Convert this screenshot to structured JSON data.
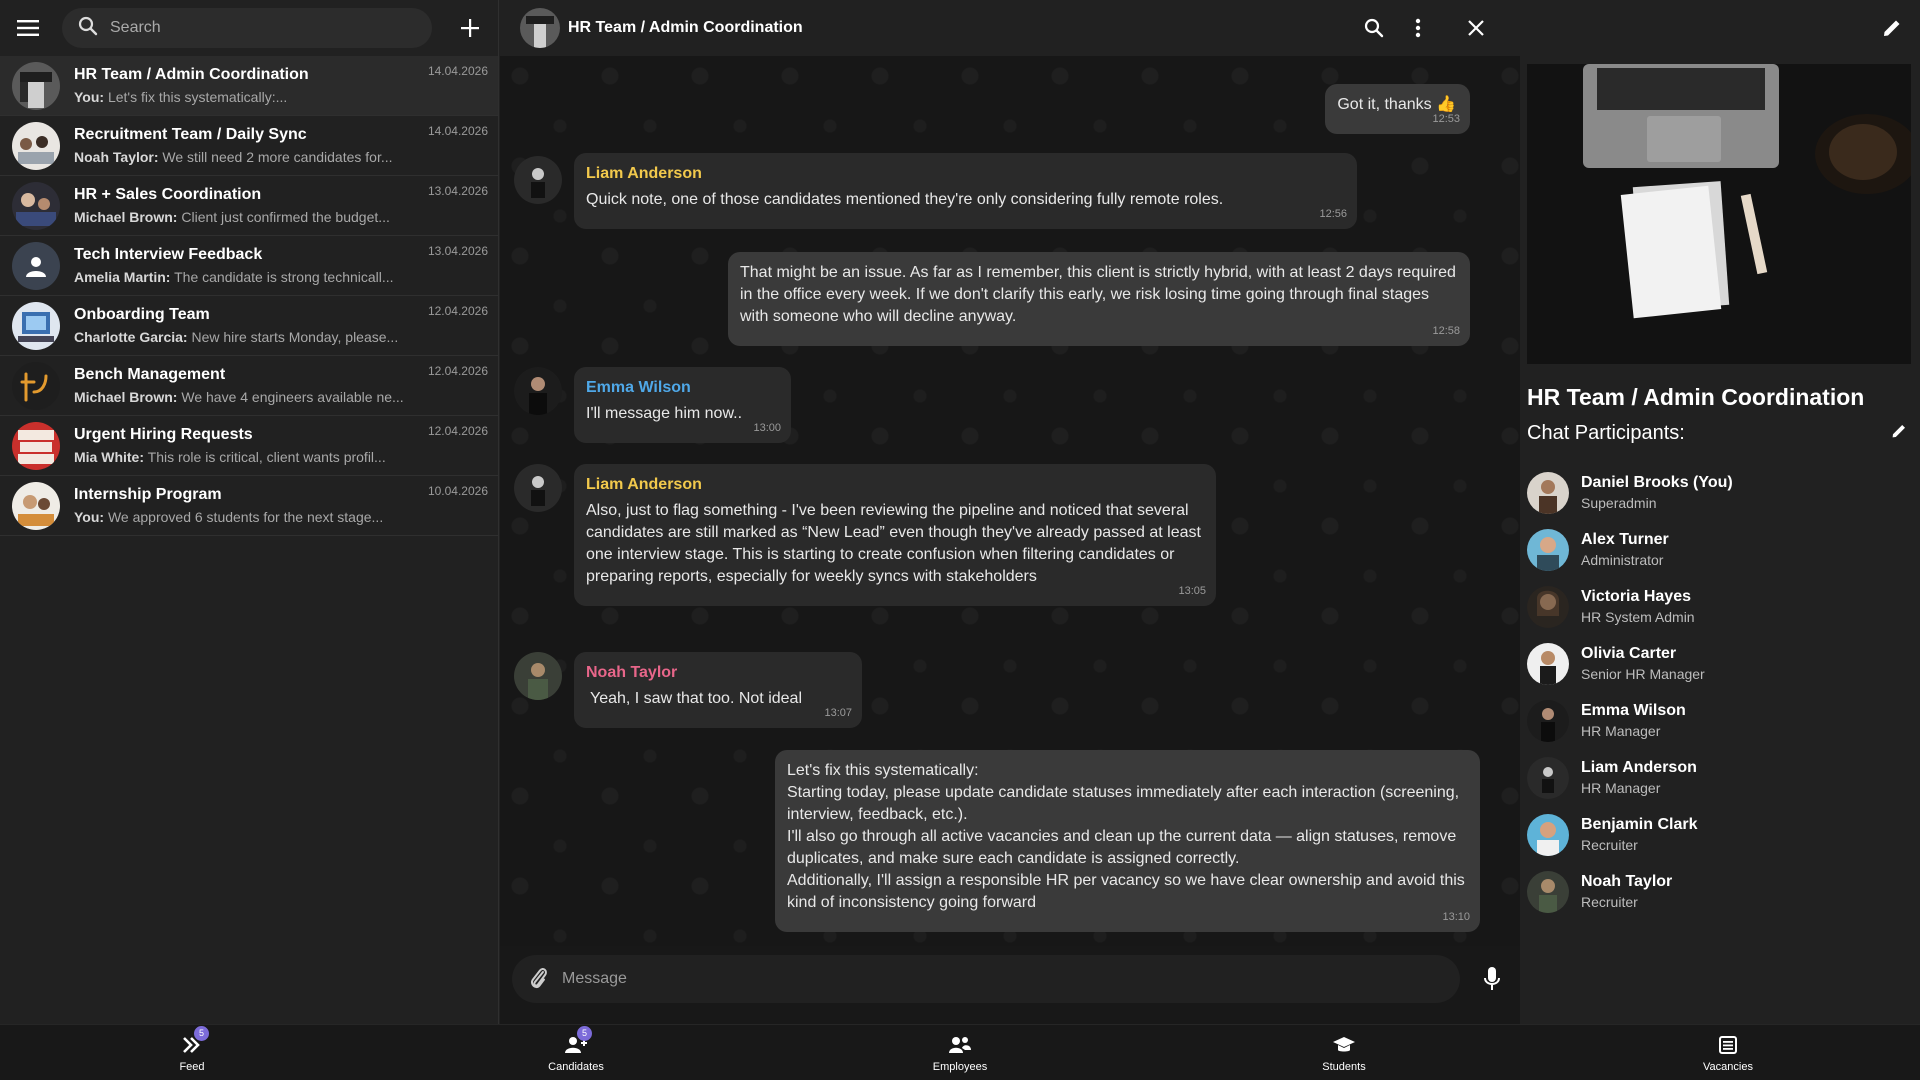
{
  "colors": {
    "accent_purple": "#7c6bd9",
    "liam": "#f2c94c",
    "emma": "#4fa8e8",
    "noah": "#e8668a"
  },
  "search": {
    "placeholder": "Search"
  },
  "chats": [
    {
      "title": "HR Team / Admin Coordination",
      "sender": "You:",
      "preview": "Let's fix this systematically:...",
      "date": "14.04.2026"
    },
    {
      "title": "Recruitment Team / Daily Sync",
      "sender": "Noah Taylor:",
      "preview": "We still need 2 more candidates for...",
      "date": "14.04.2026"
    },
    {
      "title": "HR + Sales Coordination",
      "sender": "Michael Brown:",
      "preview": "Client just confirmed the budget...",
      "date": "13.04.2026"
    },
    {
      "title": "Tech Interview Feedback",
      "sender": "Amelia Martin:",
      "preview": "The candidate is strong technicall...",
      "date": "13.04.2026"
    },
    {
      "title": "Onboarding Team",
      "sender": "Charlotte Garcia:",
      "preview": "New hire starts Monday, please...",
      "date": "12.04.2026"
    },
    {
      "title": "Bench Management",
      "sender": "Michael Brown:",
      "preview": "We have 4 engineers available ne...",
      "date": "12.04.2026"
    },
    {
      "title": "Urgent Hiring Requests",
      "sender": "Mia White:",
      "preview": "This role is critical, client wants profil...",
      "date": "12.04.2026"
    },
    {
      "title": "Internship Program",
      "sender": "You:",
      "preview": "We approved 6 students for the next stage...",
      "date": "10.04.2026"
    }
  ],
  "conversation": {
    "title": "HR Team / Admin Coordination",
    "messages": [
      {
        "own": true,
        "text": "Got it, thanks 👍",
        "time": "12:53"
      },
      {
        "author": "Liam Anderson",
        "text": "Quick note, one of those candidates mentioned they're only considering fully remote roles.",
        "time": "12:56"
      },
      {
        "own": true,
        "text": "That might be an issue. As far as I remember, this client is strictly hybrid, with at least 2 days required in the office every week. If we don't clarify this early, we risk losing time going through final stages with someone who will decline anyway.",
        "time": "12:58"
      },
      {
        "author": "Emma Wilson",
        "text": "I'll message him now..",
        "time": "13:00"
      },
      {
        "author": "Liam Anderson",
        "text": "Also, just to flag something - I've been reviewing the pipeline and noticed that several candidates are still marked as “New Lead” even though they've already passed at least one interview stage. This is starting to create confusion when filtering candidates or preparing reports, especially for weekly syncs with stakeholders",
        "time": "13:05"
      },
      {
        "author": "Noah Taylor",
        "text": "Yeah, I saw that too. Not ideal",
        "time": "13:07"
      },
      {
        "own": true,
        "text": "Let's fix this systematically:\nStarting today, please update candidate statuses immediately after each interaction (screening, interview, feedback, etc.).\nI'll also go through all active vacancies and clean up the current data — align statuses, remove duplicates, and make sure each candidate is assigned correctly.\nAdditionally, I'll assign a responsible HR per vacancy so we have clear ownership and avoid this kind of inconsistency going forward",
        "time": "13:10"
      }
    ]
  },
  "composer": {
    "placeholder": "Message"
  },
  "info": {
    "title": "HR Team / Admin Coordination",
    "participants_label": "Chat Participants:",
    "participants": [
      {
        "name": "Daniel Brooks (You)",
        "role": "Superadmin"
      },
      {
        "name": "Alex Turner",
        "role": "Administrator"
      },
      {
        "name": "Victoria Hayes",
        "role": "HR System Admin"
      },
      {
        "name": "Olivia Carter",
        "role": "Senior HR Manager"
      },
      {
        "name": "Emma Wilson",
        "role": "HR Manager"
      },
      {
        "name": "Liam Anderson",
        "role": "HR Manager"
      },
      {
        "name": "Benjamin Clark",
        "role": "Recruiter"
      },
      {
        "name": "Noah Taylor",
        "role": "Recruiter"
      }
    ]
  },
  "nav": [
    {
      "label": "Feed",
      "icon": "feed-icon",
      "badge": "5"
    },
    {
      "label": "Candidates",
      "icon": "candidates-icon",
      "badge": "5"
    },
    {
      "label": "Employees",
      "icon": "employees-icon",
      "badge": ""
    },
    {
      "label": "Students",
      "icon": "graduation-cap-icon",
      "badge": ""
    },
    {
      "label": "Vacancies",
      "icon": "vacancies-icon",
      "badge": ""
    }
  ]
}
